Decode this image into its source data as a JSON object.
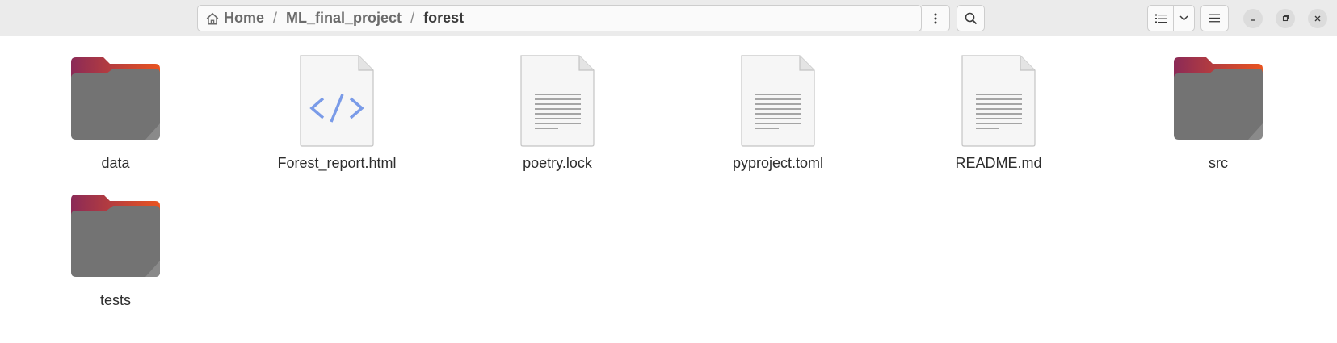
{
  "pathbar": {
    "home": "Home",
    "parent": "ML_final_project",
    "current": "forest",
    "separator": "/"
  },
  "toolbar": {
    "path_menu_icon": "vertical-dots-icon",
    "search_icon": "search-icon",
    "view_icon": "list-view-icon",
    "view_dropdown_icon": "chevron-down-icon",
    "menu_icon": "hamburger-menu-icon"
  },
  "window_controls": {
    "minimize_icon": "minimize-icon",
    "maximize_icon": "maximize-icon",
    "close_icon": "close-icon"
  },
  "files": [
    {
      "name": "data",
      "type": "folder"
    },
    {
      "name": "Forest_report.html",
      "type": "html"
    },
    {
      "name": "poetry.lock",
      "type": "text"
    },
    {
      "name": "pyproject.toml",
      "type": "text"
    },
    {
      "name": "README.md",
      "type": "text"
    },
    {
      "name": "src",
      "type": "folder"
    },
    {
      "name": "tests",
      "type": "folder"
    }
  ],
  "colors": {
    "folder_body": "#737373",
    "folder_tab_start": "#8b2a57",
    "folder_tab_end": "#e95420",
    "html_code": "#7a9be8"
  }
}
